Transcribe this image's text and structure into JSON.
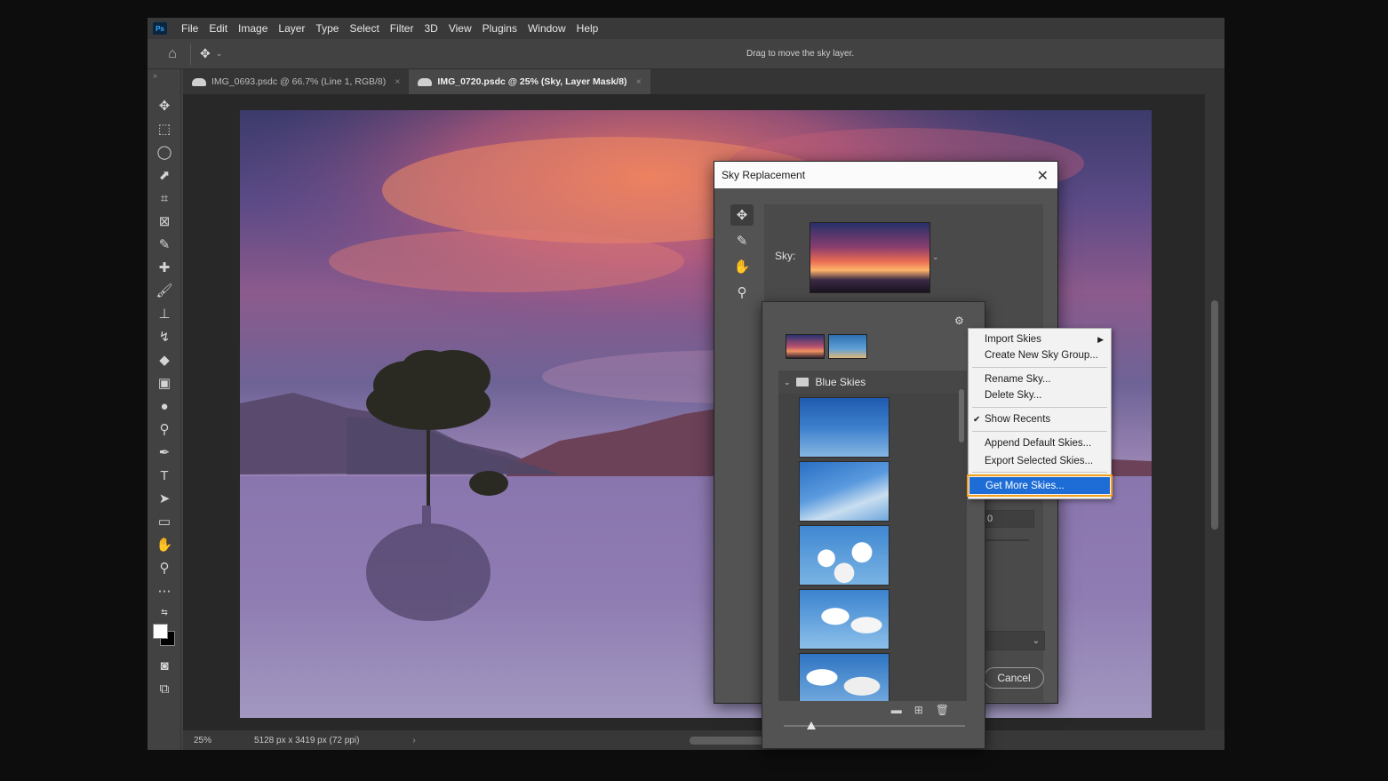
{
  "app": {
    "logo_text": "Ps",
    "menu": [
      "File",
      "Edit",
      "Image",
      "Layer",
      "Type",
      "Select",
      "Filter",
      "3D",
      "View",
      "Plugins",
      "Window",
      "Help"
    ]
  },
  "options_bar": {
    "hint": "Drag to move the sky layer."
  },
  "tabs": [
    {
      "label": "IMG_0693.psdc @ 66.7% (Line 1, RGB/8)",
      "close": "×"
    },
    {
      "label": "IMG_0720.psdc @ 25% (Sky, Layer Mask/8)",
      "close": "×"
    }
  ],
  "status": {
    "zoom": "25%",
    "info": "5128 px x 3419 px (72 ppi)",
    "arrow": "›"
  },
  "dialog": {
    "title": "Sky Replacement",
    "close": "✕",
    "sky_label": "Sky:",
    "cancel": "Cancel",
    "partial_value": "0"
  },
  "picker": {
    "group_name": "Blue Skies"
  },
  "context_menu": {
    "items": [
      {
        "label": "Import Skies",
        "has_submenu": true
      },
      {
        "label": "Create New Sky Group..."
      },
      {
        "label": "Rename Sky..."
      },
      {
        "label": "Delete Sky..."
      },
      {
        "label": "Show Recents",
        "checked": true
      },
      {
        "label": "Append Default Skies..."
      },
      {
        "label": "Export Selected Skies..."
      },
      {
        "label": "Get More Skies...",
        "highlighted": true
      }
    ]
  },
  "colors": {
    "highlight_blue": "#1e6dd6",
    "highlight_outline": "#f4a01c"
  }
}
